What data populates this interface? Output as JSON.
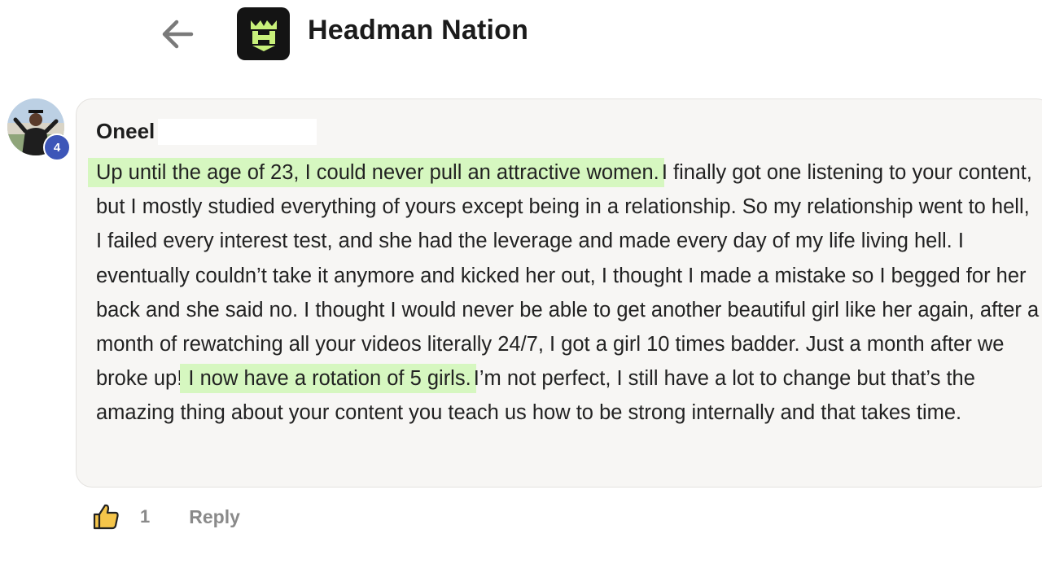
{
  "header": {
    "back_icon": "arrow-left-icon",
    "group_logo_icon": "headman-crown-logo",
    "group_name": "Headman Nation"
  },
  "comment": {
    "author": "Oneel",
    "author_level": "4",
    "avatar_icon": "user-avatar-photo",
    "highlight_color": "#d6f7c0",
    "bubble_color": "#f7f6f4",
    "body": [
      {
        "text": "Up until the age of 23, I could never pull an attractive women.",
        "highlight": true
      },
      {
        "text": " I finally got one listening to your content, but I mostly studied everything of yours except being in a relationship. So my relationship went to hell, I failed every interest test, and she had the leverage and made every day of my life living hell. I eventually couldn’t take it anymore and kicked her out, I thought I made a mistake so I begged for her back and she said no. I thought I would never be able to get another beautiful girl like her again, after a month of rewatching all your videos literally 24/7, I got a girl 10 times badder. Just a month after we broke up! ",
        "highlight": false
      },
      {
        "text": "I now have a rotation of 5 girls.",
        "highlight": true
      },
      {
        "text": " I’m not perfect, I still have a lot to change but that’s the amazing thing about your content you teach us how to be strong internally and that takes time.",
        "highlight": false
      }
    ]
  },
  "actions": {
    "like_icon": "thumbs-up-icon",
    "like_count": "1",
    "reply_label": "Reply"
  }
}
